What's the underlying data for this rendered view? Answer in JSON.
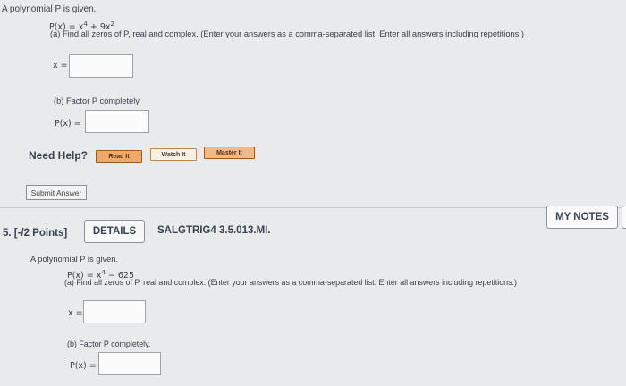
{
  "q4": {
    "intro": "A polynomial P is given.",
    "poly_prefix": "P(x) = x",
    "poly_exp1": "4",
    "poly_mid": " + 9x",
    "poly_exp2": "2",
    "part_a": "(a) Find all zeros of P, real and complex. (Enter your answers as a comma-separated list. Enter all answers including repetitions.)",
    "x_label": "x =",
    "part_b": "(b) Factor P completely.",
    "p_label": "P(x) ="
  },
  "help": {
    "label": "Need Help?",
    "read": "Read It",
    "watch": "Watch It",
    "master": "Master It"
  },
  "submit_label": "Submit Answer",
  "q5": {
    "number": "5.",
    "points": "[-/2 Points]",
    "details_label": "DETAILS",
    "code": "SALGTRIG4 3.5.013.MI.",
    "my_notes": "MY NOTES",
    "intro": "A polynomial P is given.",
    "poly_prefix": "P(x) = x",
    "poly_exp1": "4",
    "poly_mid": " − 625",
    "part_a": "(a) Find all zeros of P, real and complex. (Enter your answers as a comma-separated list. Enter all answers including repetitions.)",
    "x_label": "x =",
    "part_b": "(b) Factor P completely.",
    "p_label": "P(x) ="
  }
}
